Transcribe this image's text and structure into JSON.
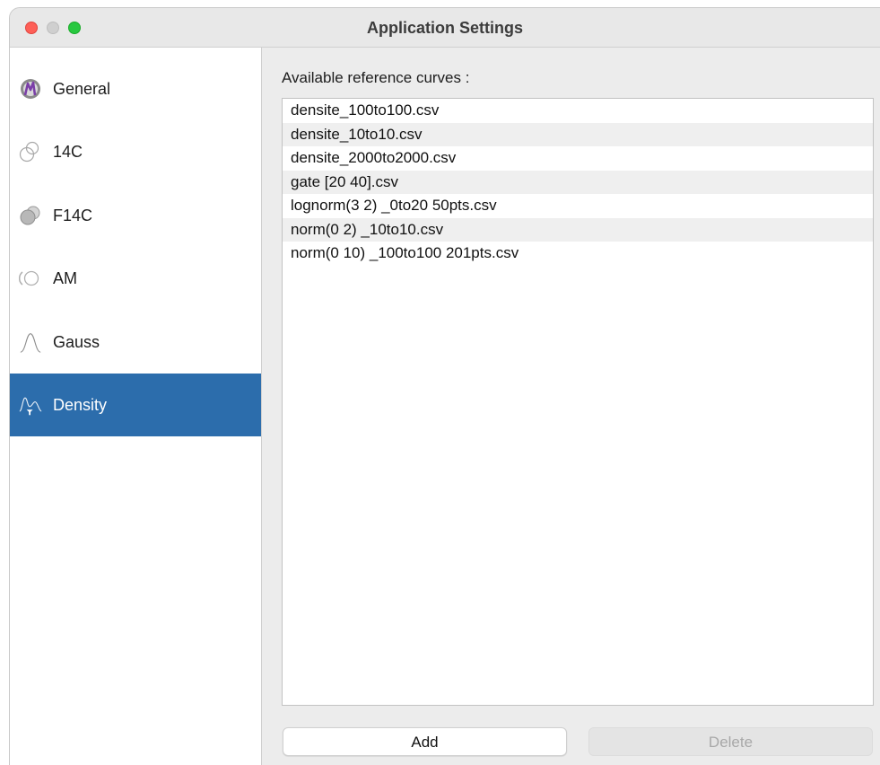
{
  "window": {
    "title": "Application Settings"
  },
  "sidebar": {
    "items": [
      {
        "label": "General",
        "icon": "chronomodel-logo-icon",
        "selected": false
      },
      {
        "label": "14C",
        "icon": "overlapping-circles-icon",
        "selected": false
      },
      {
        "label": "F14C",
        "icon": "filled-circles-icon",
        "selected": false
      },
      {
        "label": "AM",
        "icon": "ring-icon",
        "selected": false
      },
      {
        "label": "Gauss",
        "icon": "bell-curve-icon",
        "selected": false
      },
      {
        "label": "Density",
        "icon": "density-curve-icon",
        "selected": true
      }
    ]
  },
  "main": {
    "caption": "Available reference curves :",
    "curves": [
      "densite_100to100.csv",
      "densite_10to10.csv",
      "densite_2000to2000.csv",
      "gate [20  40].csv",
      "lognorm(3  2) _0to20 50pts.csv",
      "norm(0   2) _10to10.csv",
      "norm(0  10) _100to100 201pts.csv"
    ],
    "add_label": "Add",
    "delete_label": "Delete"
  },
  "colors": {
    "selection": "#2c6dac",
    "close": "#fe5f57",
    "zoom": "#28c840"
  }
}
